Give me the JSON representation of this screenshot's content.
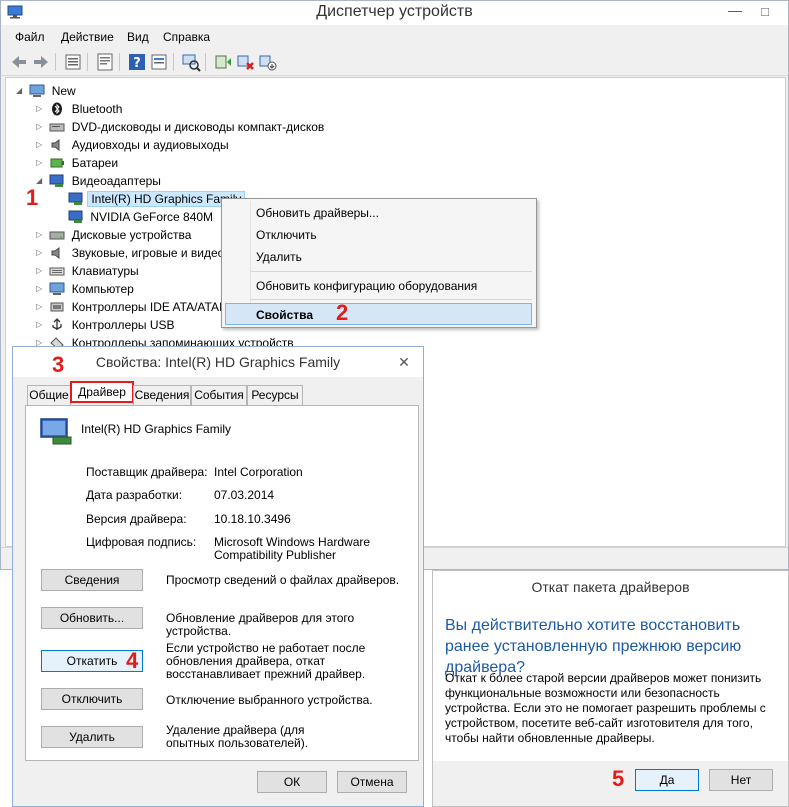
{
  "colors": {
    "marker": "#e31b1b",
    "question_blue": "#1c5aa6",
    "selection": "#cce8ff"
  },
  "main_window": {
    "title": "Диспетчер устройств",
    "min_glyph": "—",
    "max_glyph": "□",
    "menu": [
      "Файл",
      "Действие",
      "Вид",
      "Справка"
    ],
    "tree": {
      "root": "New",
      "items": [
        "Bluetooth",
        "DVD-дисководы и дисководы компакт-дисков",
        "Аудиовходы и аудиовыходы",
        "Батареи",
        "Видеоадаптеры",
        "Intel(R) HD Graphics Family",
        "NVIDIA GeForce 840M",
        "Дисковые устройства",
        "Звуковые, игровые и видео",
        "Клавиатуры",
        "Компьютер",
        "Контроллеры IDE ATA/ATAI",
        "Контроллеры USB",
        "Контроллеры запоминающих устройств"
      ]
    }
  },
  "context_menu": {
    "items": [
      "Обновить драйверы...",
      "Отключить",
      "Удалить",
      "Обновить конфигурацию оборудования",
      "Свойства"
    ]
  },
  "markers": [
    "1",
    "2",
    "3",
    "4",
    "5"
  ],
  "properties": {
    "title": "Свойства: Intel(R) HD Graphics Family",
    "close_glyph": "✕",
    "tabs": [
      "Общие",
      "Драйвер",
      "Сведения",
      "События",
      "Ресурсы"
    ],
    "device_name": "Intel(R) HD Graphics Family",
    "rows": [
      {
        "key": "Поставщик драйвера:",
        "value": "Intel Corporation"
      },
      {
        "key": "Дата разработки:",
        "value": "07.03.2014"
      },
      {
        "key": "Версия драйвера:",
        "value": "10.18.10.3496"
      },
      {
        "key": "Цифровая подпись:",
        "value": "Microsoft Windows Hardware",
        "value2": "Compatibility Publisher"
      }
    ],
    "buttons": [
      {
        "label": "Сведения",
        "desc": "Просмотр сведений о файлах драйверов."
      },
      {
        "label": "Обновить...",
        "desc": "Обновление драйверов для этого устройства."
      },
      {
        "label": "Откатить",
        "desc": "Если устройство не работает после обновления драйвера, откат восстанавливает прежний драйвер."
      },
      {
        "label": "Отключить",
        "desc": "Отключение выбранного устройства."
      },
      {
        "label": "Удалить",
        "desc": "Удаление драйвера (для опытных пользователей)."
      }
    ],
    "ok_label": "ОК",
    "cancel_label": "Отмена"
  },
  "rollback": {
    "title": "Откат пакета драйверов",
    "question": "Вы действительно хотите восстановить ранее установленную прежнюю версию драйвера?",
    "text": "Откат к более старой версии драйверов может понизить функциональные возможности или безопасность устройства. Если это не помогает разрешить проблемы с устройством, посетите веб-сайт изготовителя для того, чтобы найти обновленные драйверы.",
    "yes_label": "Да",
    "no_label": "Нет"
  }
}
